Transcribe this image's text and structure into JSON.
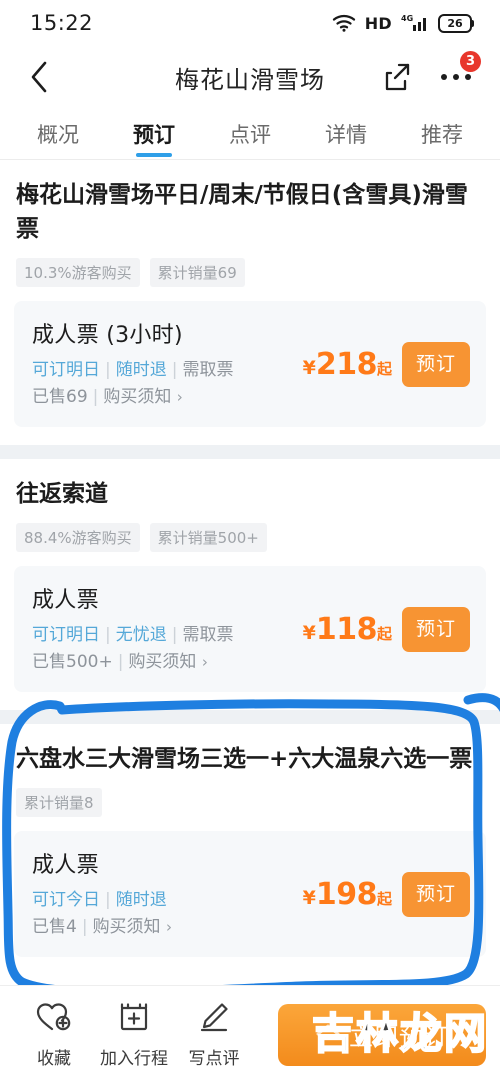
{
  "status_bar": {
    "time": "15:22",
    "hd_label": "HD",
    "network": "4G",
    "battery": "26",
    "icons": [
      "wifi-icon",
      "hd-icon",
      "signal-icon",
      "battery-icon"
    ]
  },
  "nav": {
    "back_icon": "back-chevron-icon",
    "title": "梅花山滑雪场",
    "share_icon": "share-icon",
    "more_icon": "more-dots-icon",
    "badge": "3"
  },
  "tabs": [
    {
      "label": "概况",
      "active": false
    },
    {
      "label": "预订",
      "active": true
    },
    {
      "label": "点评",
      "active": false
    },
    {
      "label": "详情",
      "active": false
    },
    {
      "label": "推荐",
      "active": false
    }
  ],
  "products": [
    {
      "title": "梅花山滑雪场平日/周末/节假日(含雪具)滑雪票",
      "tags": [
        "10.3%游客购买",
        "累计销量69"
      ],
      "tickets": [
        {
          "name": "成人票 (3小时)",
          "feature_tags": [
            "可订明日",
            "随时退",
            "需取票"
          ],
          "highlight_count": 2,
          "sold": "已售69",
          "notice": "购买须知",
          "chevron": "›",
          "currency": "¥",
          "price": "218",
          "price_suffix": "起",
          "book_label": "预订"
        }
      ]
    },
    {
      "title": "往返索道",
      "tags": [
        "88.4%游客购买",
        "累计销量500+"
      ],
      "tickets": [
        {
          "name": "成人票",
          "feature_tags": [
            "可订明日",
            "无忧退",
            "需取票"
          ],
          "highlight_count": 2,
          "sold": "已售500+",
          "notice": "购买须知",
          "chevron": "›",
          "currency": "¥",
          "price": "118",
          "price_suffix": "起",
          "book_label": "预订"
        }
      ]
    },
    {
      "title": "六盘水三大滑雪场三选一+六大温泉六选一票",
      "tags": [
        "累计销量8"
      ],
      "annotated": true,
      "tickets": [
        {
          "name": "成人票",
          "feature_tags": [
            "可订今日",
            "随时退"
          ],
          "highlight_count": 2,
          "sold": "已售4",
          "notice": "购买须知",
          "chevron": "›",
          "currency": "¥",
          "price": "198",
          "price_suffix": "起",
          "book_label": "预订"
        }
      ]
    }
  ],
  "bottom_bar": {
    "items": [
      {
        "icon": "heart-plus-icon",
        "label": "收藏"
      },
      {
        "icon": "calendar-plus-icon",
        "label": "加入行程"
      },
      {
        "icon": "pencil-icon",
        "label": "写点评"
      }
    ],
    "cta_icon": "chevron-up-icon",
    "cta_label": "立即预订"
  },
  "overlay": {
    "annotation_color": "#1f7fe0",
    "watermark": "吉林龙网"
  },
  "colors": {
    "accent_orange": "#f79433",
    "price_orange": "#ff7a18",
    "tab_blue": "#2f9fe8",
    "link_blue": "#55a8d8",
    "badge_red": "#e8372c"
  }
}
